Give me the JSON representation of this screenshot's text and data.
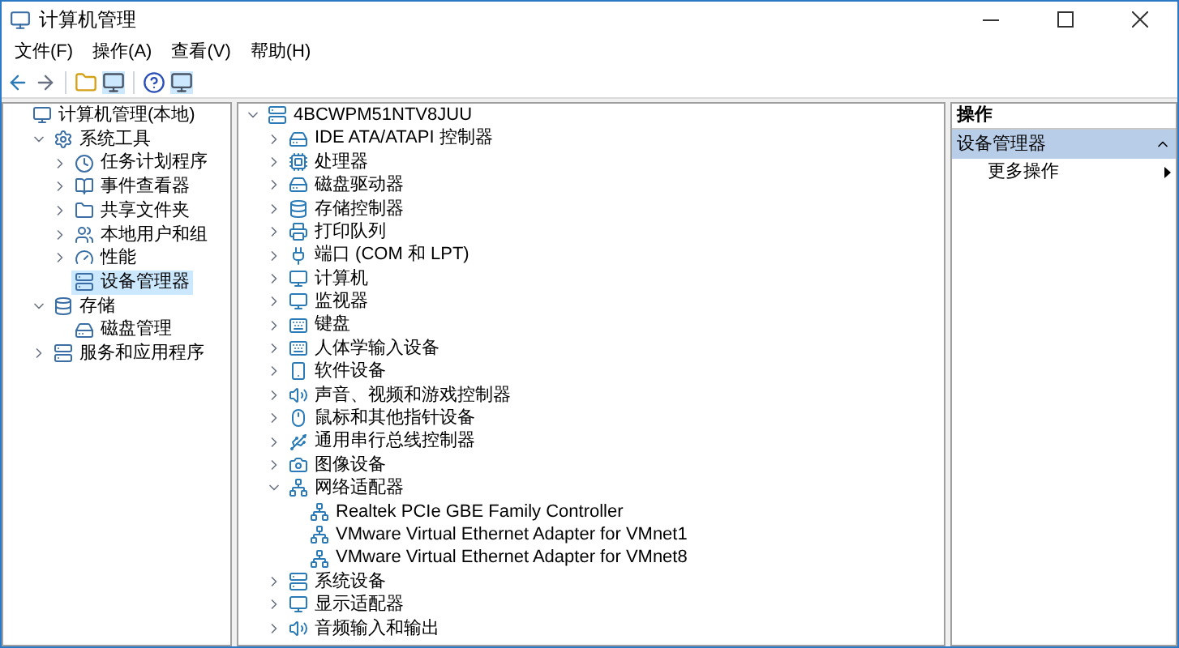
{
  "window": {
    "title": "计算机管理"
  },
  "menu": [
    "文件(F)",
    "操作(A)",
    "查看(V)",
    "帮助(H)"
  ],
  "nav_tree": [
    {
      "label": "计算机管理(本地)",
      "selected": false,
      "children": [
        {
          "label": "系统工具",
          "expanded": true,
          "selected": false,
          "children": [
            {
              "label": "任务计划程序",
              "expanded": false,
              "selected": false
            },
            {
              "label": "事件查看器",
              "expanded": false,
              "selected": false
            },
            {
              "label": "共享文件夹",
              "expanded": false,
              "selected": false
            },
            {
              "label": "本地用户和组",
              "expanded": false,
              "selected": false
            },
            {
              "label": "性能",
              "expanded": false,
              "selected": false
            },
            {
              "label": "设备管理器",
              "selected": true
            }
          ]
        },
        {
          "label": "存储",
          "expanded": true,
          "selected": false,
          "children": [
            {
              "label": "磁盘管理",
              "selected": false
            }
          ]
        },
        {
          "label": "服务和应用程序",
          "expanded": false,
          "selected": false
        }
      ]
    }
  ],
  "device_tree": {
    "label": "4BCWPM51NTV8JUU",
    "expanded": true,
    "children": [
      {
        "label": "IDE ATA/ATAPI 控制器",
        "expanded": false
      },
      {
        "label": "处理器",
        "expanded": false
      },
      {
        "label": "磁盘驱动器",
        "expanded": false
      },
      {
        "label": "存储控制器",
        "expanded": false
      },
      {
        "label": "打印队列",
        "expanded": false
      },
      {
        "label": "端口 (COM 和 LPT)",
        "expanded": false
      },
      {
        "label": "计算机",
        "expanded": false
      },
      {
        "label": "监视器",
        "expanded": false
      },
      {
        "label": "键盘",
        "expanded": false
      },
      {
        "label": "人体学输入设备",
        "expanded": false
      },
      {
        "label": "软件设备",
        "expanded": false
      },
      {
        "label": "声音、视频和游戏控制器",
        "expanded": false
      },
      {
        "label": "鼠标和其他指针设备",
        "expanded": false
      },
      {
        "label": "通用串行总线控制器",
        "expanded": false
      },
      {
        "label": "图像设备",
        "expanded": false
      },
      {
        "label": "网络适配器",
        "expanded": true,
        "children": [
          {
            "label": "Realtek PCIe GBE Family Controller"
          },
          {
            "label": "VMware Virtual Ethernet Adapter for VMnet1"
          },
          {
            "label": "VMware Virtual Ethernet Adapter for VMnet8"
          }
        ]
      },
      {
        "label": "系统设备",
        "expanded": false
      },
      {
        "label": "显示适配器",
        "expanded": false
      },
      {
        "label": "音频输入和输出",
        "expanded": false
      }
    ]
  },
  "actions": {
    "title": "操作",
    "section": "设备管理器",
    "items": [
      "更多操作"
    ]
  }
}
